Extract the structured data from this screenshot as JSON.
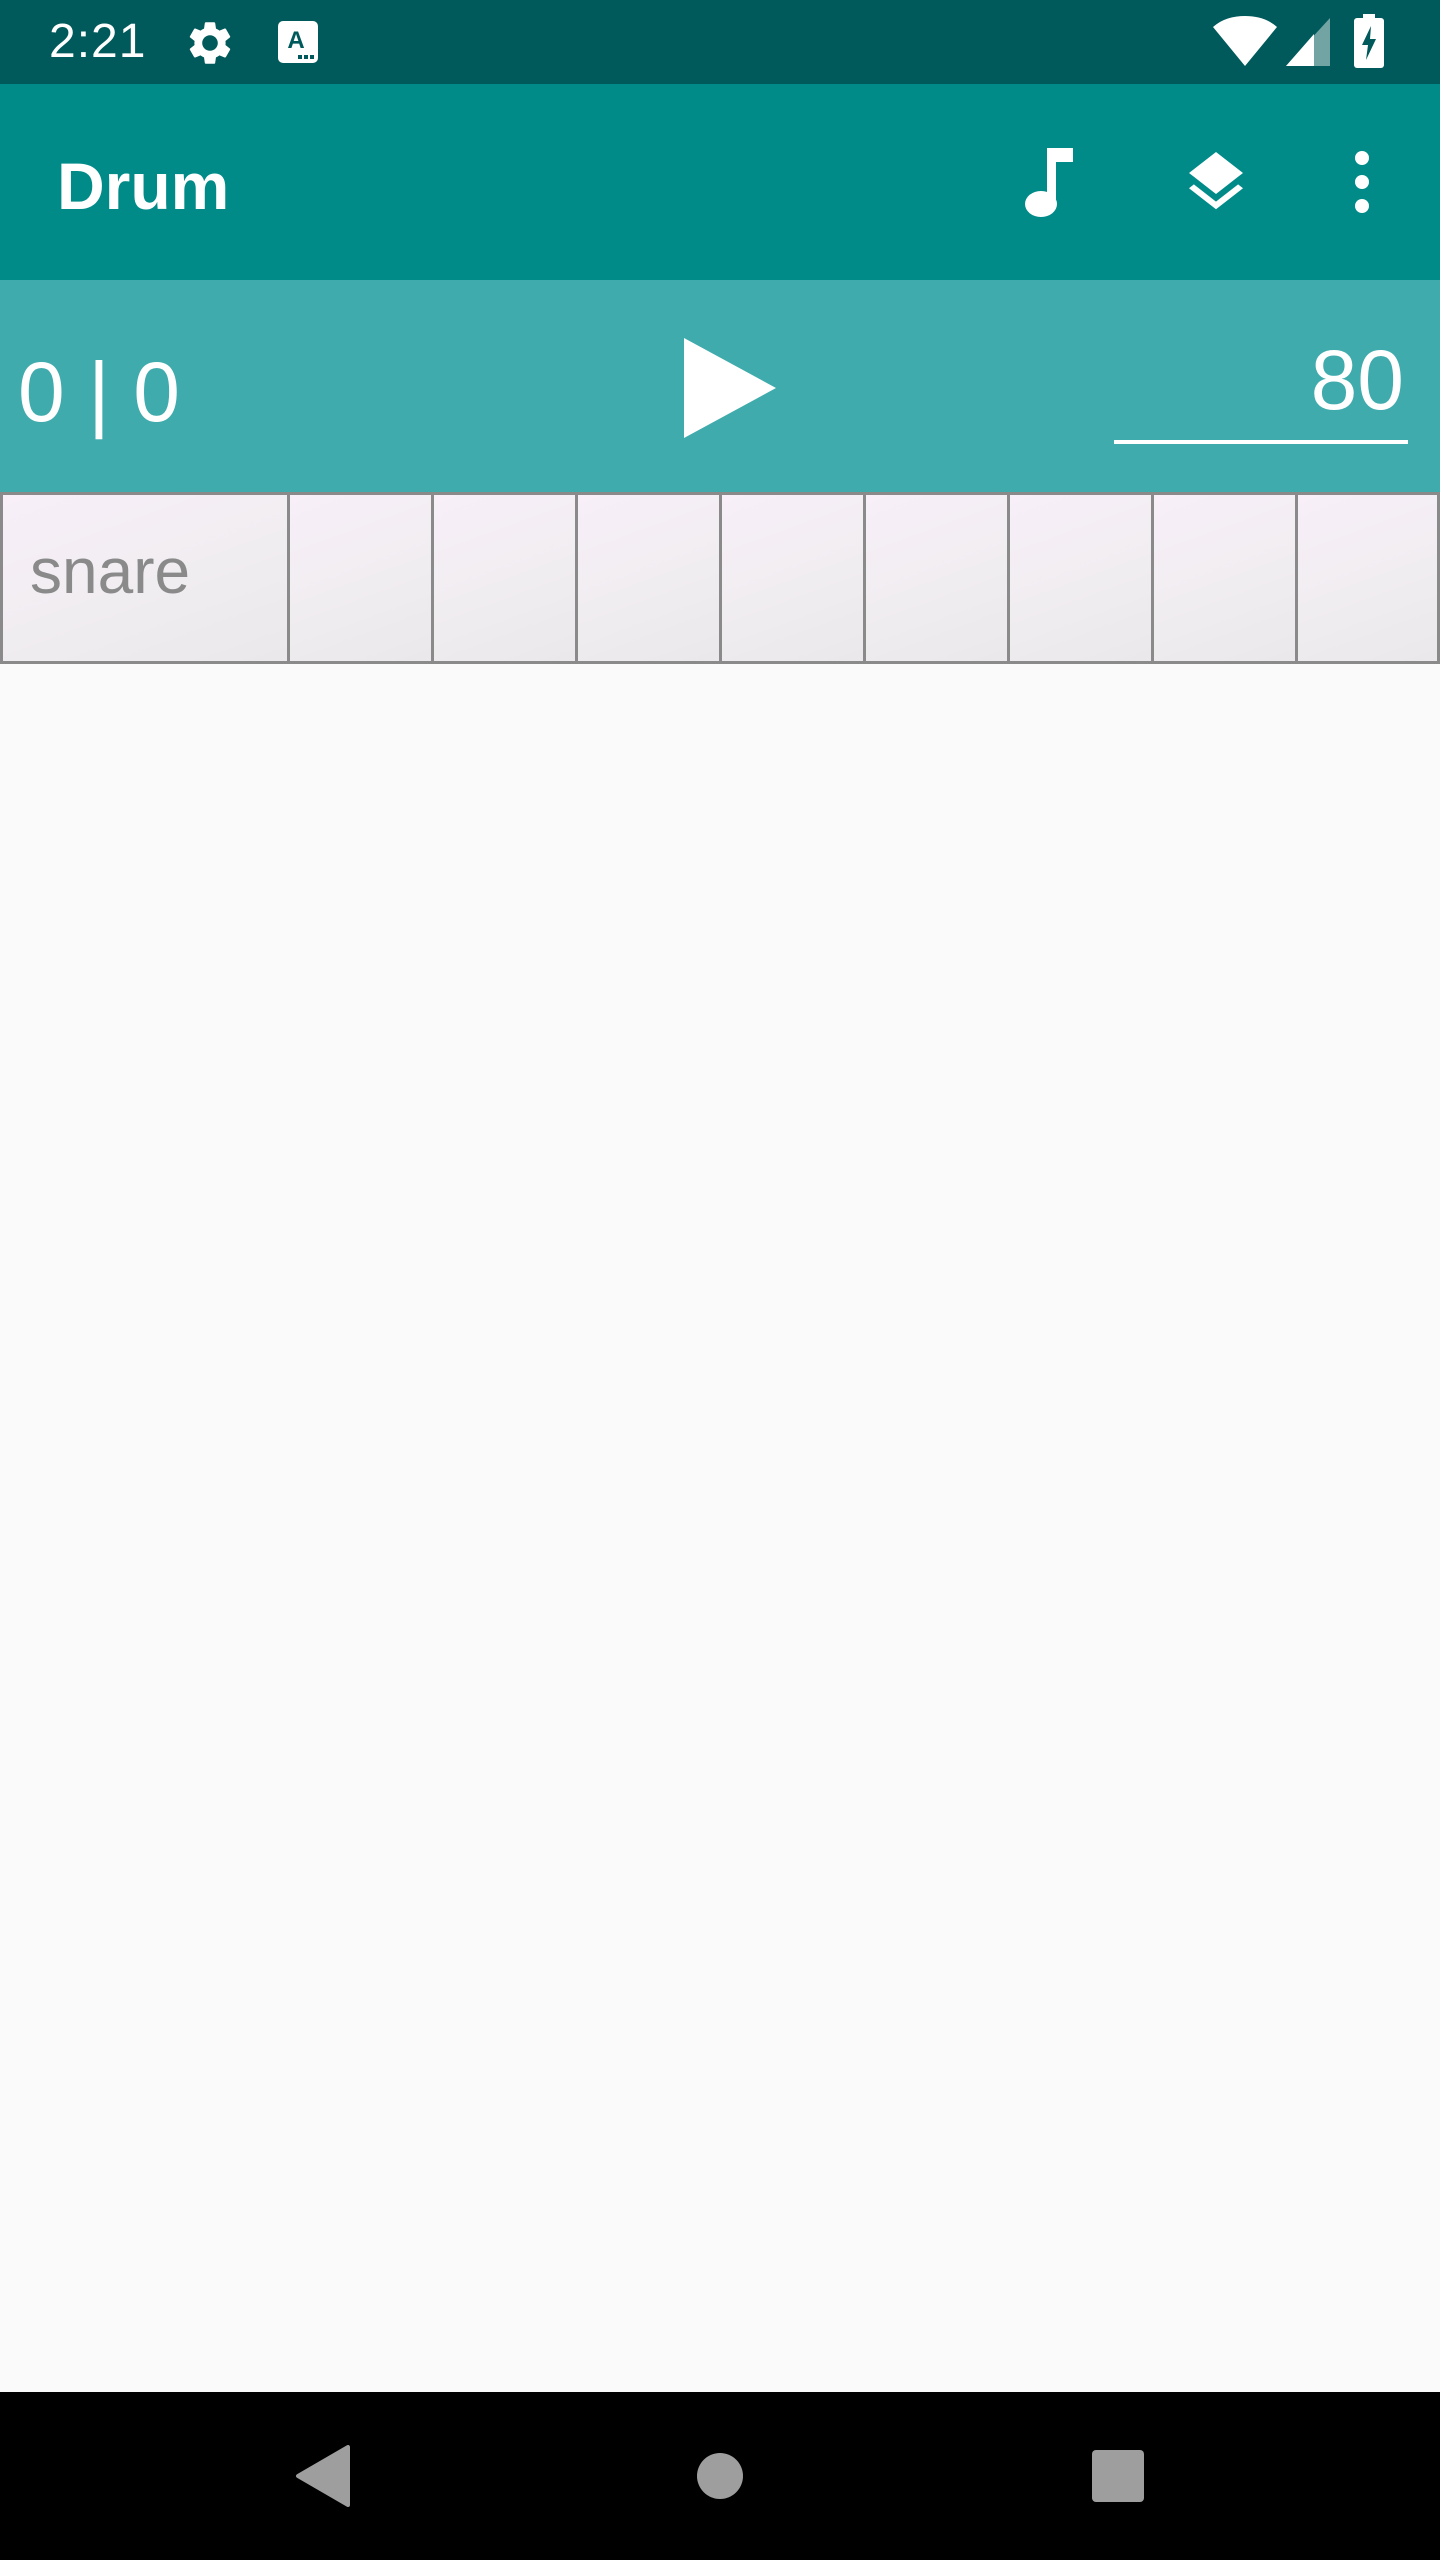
{
  "status_bar": {
    "time": "2:21",
    "left_icons": [
      "settings-icon",
      "keyboard-a-icon"
    ],
    "right_icons": [
      "wifi-icon",
      "signal-icon",
      "battery-charging-icon"
    ]
  },
  "app_bar": {
    "title": "Drum",
    "actions": [
      "music-note-icon",
      "layers-icon",
      "overflow-menu-icon"
    ]
  },
  "controls": {
    "counter": "0 | 0",
    "play_icon": "play-icon",
    "tempo": "80"
  },
  "sequencer": {
    "tracks": [
      {
        "instrument": "snare",
        "steps": [
          false,
          false,
          false,
          false,
          false,
          false,
          false,
          false
        ]
      }
    ]
  },
  "nav_bar": {
    "buttons": [
      "back-icon",
      "home-icon",
      "recents-icon"
    ]
  },
  "colors": {
    "status_bar": "#00595a",
    "app_bar": "#008b89",
    "control_bar": "#3fabad",
    "background": "#fafafa",
    "cell_border": "#8a8a8a"
  }
}
